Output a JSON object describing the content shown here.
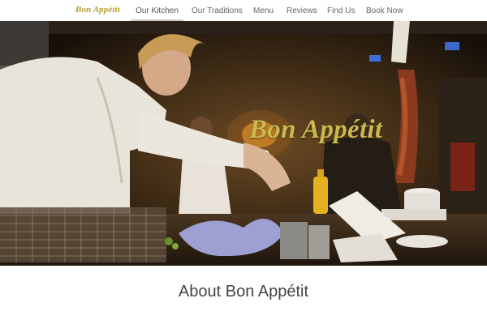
{
  "brand": {
    "name": "Bon Appétit"
  },
  "nav": {
    "items": [
      {
        "label": "Our Kitchen",
        "active": true
      },
      {
        "label": "Our Traditions",
        "active": false
      },
      {
        "label": "Menu",
        "active": false
      },
      {
        "label": "Reviews",
        "active": false
      },
      {
        "label": "Find Us",
        "active": false
      },
      {
        "label": "Book Now",
        "active": false
      }
    ]
  },
  "hero": {
    "title": "Bon Appétit",
    "image": "chef-in-kitchen-photo"
  },
  "about": {
    "title": "About Bon Appétit"
  },
  "colors": {
    "accent": "#b5a033",
    "hero_title": "#c9b94e",
    "nav_text": "#666666",
    "heading_text": "#444444"
  }
}
